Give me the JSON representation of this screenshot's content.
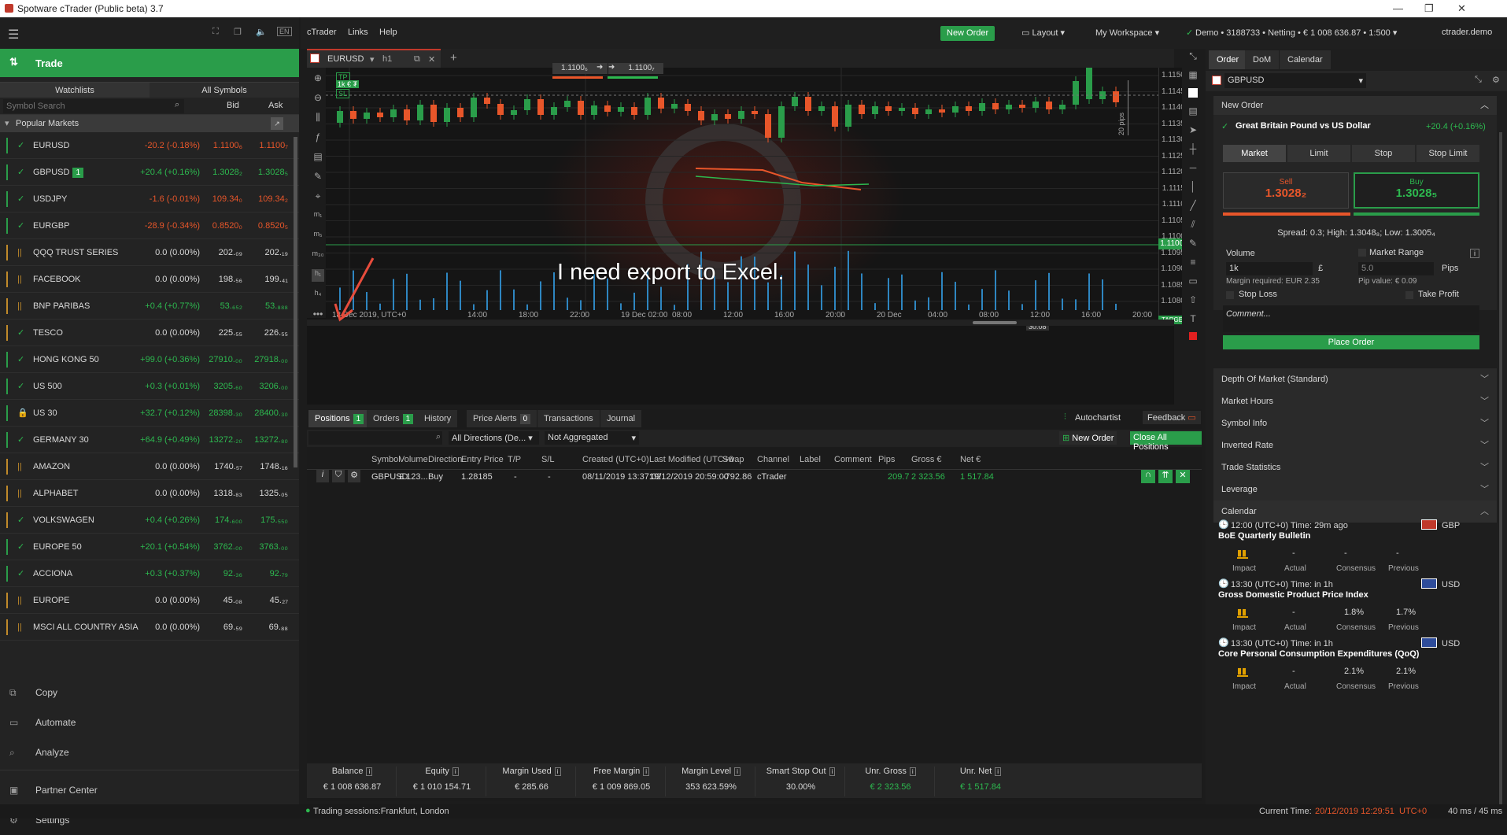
{
  "window": {
    "title": "Spotware cTrader (Public beta) 3.7",
    "min": "—",
    "max": "❐",
    "close": "✕"
  },
  "left": {
    "trade_label": "Trade",
    "tabs": [
      "Watchlists",
      "All Symbols"
    ],
    "search_placeholder": "Symbol Search",
    "bid_hdr": "Bid",
    "ask_hdr": "Ask",
    "popular": "Popular Markets",
    "symbols": [
      {
        "name": "EURUSD",
        "chg": "-20.2 (-0.18%)",
        "bid": "1.1100₆",
        "ask": "1.1100₇",
        "dir": "neg",
        "bar": "#2a9d4a",
        "icon": "✓"
      },
      {
        "name": "GBPUSD",
        "chg": "+20.4 (+0.16%)",
        "bid": "1.3028₂",
        "ask": "1.3028₅",
        "dir": "pos",
        "bar": "#2a9d4a",
        "icon": "✓",
        "badge": "1"
      },
      {
        "name": "USDJPY",
        "chg": "-1.6 (-0.01%)",
        "bid": "109.34₀",
        "ask": "109.34₂",
        "dir": "neg",
        "bar": "#2a9d4a",
        "icon": "✓"
      },
      {
        "name": "EURGBP",
        "chg": "-28.9 (-0.34%)",
        "bid": "0.8520₀",
        "ask": "0.8520₅",
        "dir": "neg",
        "bar": "#2a9d4a",
        "icon": "✓"
      },
      {
        "name": "QQQ TRUST SERIES",
        "chg": "0.0 (0.00%)",
        "bid": "202.₀₉",
        "ask": "202.₁₉",
        "dir": "zero",
        "bar": "#c08a2a",
        "icon": "||"
      },
      {
        "name": "FACEBOOK",
        "chg": "0.0 (0.00%)",
        "bid": "198.₅₆",
        "ask": "199.₄₁",
        "dir": "zero",
        "bar": "#c08a2a",
        "icon": "||"
      },
      {
        "name": "BNP PARIBAS",
        "chg": "+0.4 (+0.77%)",
        "bid": "53.₆₅₂",
        "ask": "53.₈₈₈",
        "dir": "pos",
        "bar": "#c08a2a",
        "icon": "||"
      },
      {
        "name": "TESCO",
        "chg": "0.0 (0.00%)",
        "bid": "225.₅₅",
        "ask": "226.₅₅",
        "dir": "zero",
        "bar": "#c08a2a",
        "icon": "✓"
      },
      {
        "name": "HONG KONG 50",
        "chg": "+99.0 (+0.36%)",
        "bid": "27910.₀₀",
        "ask": "27918.₀₀",
        "dir": "pos",
        "bar": "#2a9d4a",
        "icon": "✓"
      },
      {
        "name": "US 500",
        "chg": "+0.3 (+0.01%)",
        "bid": "3205.₆₀",
        "ask": "3206.₀₀",
        "dir": "pos",
        "bar": "#2a9d4a",
        "icon": "✓"
      },
      {
        "name": "US 30",
        "chg": "+32.7 (+0.12%)",
        "bid": "28398.₃₀",
        "ask": "28400.₃₀",
        "dir": "pos",
        "bar": "#2a9d4a",
        "icon": "🔒"
      },
      {
        "name": "GERMANY 30",
        "chg": "+64.9 (+0.49%)",
        "bid": "13272.₂₀",
        "ask": "13272.₈₀",
        "dir": "pos",
        "bar": "#2a9d4a",
        "icon": "✓"
      },
      {
        "name": "AMAZON",
        "chg": "0.0 (0.00%)",
        "bid": "1740.₅₇",
        "ask": "1748.₁₆",
        "dir": "zero",
        "bar": "#c08a2a",
        "icon": "||"
      },
      {
        "name": "ALPHABET",
        "chg": "0.0 (0.00%)",
        "bid": "1318.₈₃",
        "ask": "1325.₀₅",
        "dir": "zero",
        "bar": "#c08a2a",
        "icon": "||"
      },
      {
        "name": "VOLKSWAGEN",
        "chg": "+0.4 (+0.26%)",
        "bid": "174.₆₀₀",
        "ask": "175.₅₅₀",
        "dir": "pos",
        "bar": "#c08a2a",
        "icon": "✓"
      },
      {
        "name": "EUROPE 50",
        "chg": "+20.1 (+0.54%)",
        "bid": "3762.₀₀",
        "ask": "3763.₀₀",
        "dir": "pos",
        "bar": "#2a9d4a",
        "icon": "✓"
      },
      {
        "name": "ACCIONA",
        "chg": "+0.3 (+0.37%)",
        "bid": "92.₃₆",
        "ask": "92.₇₉",
        "dir": "pos",
        "bar": "#2a9d4a",
        "icon": "✓"
      },
      {
        "name": "EUROPE",
        "chg": "0.0 (0.00%)",
        "bid": "45.₀₈",
        "ask": "45.₂₇",
        "dir": "zero",
        "bar": "#c08a2a",
        "icon": "||"
      },
      {
        "name": "MSCI ALL COUNTRY ASIA",
        "chg": "0.0 (0.00%)",
        "bid": "69.₅₉",
        "ask": "69.₈₈",
        "dir": "zero",
        "bar": "#c08a2a",
        "icon": "||"
      }
    ],
    "nav": [
      "Copy",
      "Automate",
      "Analyze",
      "Partner Center",
      "Settings"
    ]
  },
  "top": {
    "menus": [
      "cTrader",
      "Links",
      "Help"
    ],
    "new_order": "New Order",
    "layout": "Layout",
    "workspace": "My Workspace",
    "account": "Demo • 3188733 • Netting • € 1 008 636.87 • 1:500",
    "user": "ctrader.demo"
  },
  "chart": {
    "symbol": "EURUSD",
    "timeframe": "h1",
    "sell_price": "1.1100₆",
    "buy_price": "1.1100₇",
    "overlay": "I need export to Excel.",
    "pips_label": "20 pips",
    "current_price": "1.11007",
    "target": "TARGET",
    "timer": "30:08",
    "tp_label": "TP",
    "sl_label": "SL",
    "lot_label": "1k € ₮",
    "yticks": [
      "1.1150₀",
      "1.1145₀",
      "1.1140₀",
      "1.1135₀",
      "1.1130₀",
      "1.1125₀",
      "1.1120₀",
      "1.1115₀",
      "1.1110₀",
      "1.1105₀",
      "1.1100₀",
      "1.1095₀",
      "1.1090₀",
      "1.1085₀",
      "1.1080₀"
    ],
    "xticks": [
      "18 Dec 2019, UTC+0",
      "14:00",
      "18:00",
      "22:00",
      "19 Dec 02:00",
      "08:00",
      "12:00",
      "16:00",
      "20:00",
      "20 Dec",
      "04:00",
      "08:00",
      "12:00",
      "16:00",
      "20:00"
    ]
  },
  "bottom": {
    "tabs": [
      {
        "label": "Positions",
        "badge": "1"
      },
      {
        "label": "Orders",
        "badge": "1"
      },
      {
        "label": "History"
      },
      {
        "label": "Price Alerts",
        "badge": "0"
      },
      {
        "label": "Transactions"
      },
      {
        "label": "Journal"
      }
    ],
    "autochartist": "Autochartist",
    "feedback": "Feedback",
    "filter_dir": "All Directions (De...",
    "filter_agg": "Not Aggregated",
    "new_order": "New Order",
    "close_all": "Close All Positions",
    "columns": [
      "Symbol",
      "Volume",
      "Direction",
      "Entry Price",
      "T/P",
      "S/L",
      "Created (UTC+0)",
      "Last Modified (UTC+0",
      "Swap",
      "Channel",
      "Label",
      "Comment",
      "Pips",
      "Gross €",
      "Net €"
    ],
    "row": {
      "symbol": "GBPUSD",
      "volume": "£ 123...",
      "direction": "Buy",
      "entry": "1.28185",
      "tp": "-",
      "sl": "-",
      "created": "08/11/2019 13:37:02",
      "modified": "19/12/2019 20:59:00",
      "swap": "-792.86",
      "channel": "cTrader",
      "pips": "209.7",
      "gross": "2 323.56",
      "net": "1 517.84"
    },
    "summary": [
      {
        "k": "Balance",
        "v": "€ 1 008 636.87"
      },
      {
        "k": "Equity",
        "v": "€ 1 010 154.71"
      },
      {
        "k": "Margin Used",
        "v": "€ 285.66"
      },
      {
        "k": "Free Margin",
        "v": "€ 1 009 869.05"
      },
      {
        "k": "Margin Level",
        "v": "353 623.59%"
      },
      {
        "k": "Smart Stop Out",
        "v": "30.00%"
      },
      {
        "k": "Unr. Gross",
        "v": "€ 2 323.56"
      },
      {
        "k": "Unr. Net",
        "v": "€ 1 517.84"
      }
    ]
  },
  "right": {
    "tabs": [
      "Order",
      "DoM",
      "Calendar"
    ],
    "symbol": "GBPUSD",
    "new_order": "New Order",
    "pair_name": "Great Britain Pound vs US Dollar",
    "pair_chg": "+20.4 (+0.16%)",
    "order_types": [
      "Market",
      "Limit",
      "Stop",
      "Stop Limit"
    ],
    "sell_label": "Sell",
    "sell_price": "1.3028₂",
    "buy_label": "Buy",
    "buy_price": "1.3028₅",
    "spread": "Spread: 0.3; High: 1.3048₈; Low: 1.3005₄",
    "volume_label": "Volume",
    "volume_val": "1k",
    "currency": "£",
    "market_range": "Market Range",
    "range_val": "5.0",
    "pips": "Pips",
    "margin_req": "Margin required: EUR 2.35",
    "pip_value": "Pip value: € 0.09",
    "stop_loss": "Stop Loss",
    "take_profit": "Take Profit",
    "comment": "Comment...",
    "place_order": "Place Order",
    "sections": [
      "Depth Of Market (Standard)",
      "Market Hours",
      "Symbol Info",
      "Inverted Rate",
      "Trade Statistics",
      "Leverage"
    ],
    "calendar": "Calendar",
    "events": [
      {
        "time": "12:00  (UTC+0)  Time:  29m ago",
        "title": "BoE Quarterly Bulletin",
        "cur": "GBP",
        "actual": "-",
        "consensus": "-",
        "previous": "-"
      },
      {
        "time": "13:30  (UTC+0)  Time:  in 1h",
        "title": "Gross Domestic Product Price Index",
        "cur": "USD",
        "actual": "-",
        "consensus": "1.8%",
        "previous": "1.7%"
      },
      {
        "time": "13:30  (UTC+0)  Time:  in 1h",
        "title": "Core Personal Consumption Expenditures (QoQ)",
        "cur": "USD",
        "actual": "-",
        "consensus": "2.1%",
        "previous": "2.1%"
      }
    ],
    "cal_labels": [
      "Impact",
      "Actual",
      "Consensus",
      "Previous"
    ]
  },
  "status": {
    "sessions": "Trading sessions:Frankfurt, London",
    "current_time_label": "Current Time:",
    "current_time": "20/12/2019 12:29:51",
    "tz": "UTC+0",
    "latency": "40 ms / 45 ms"
  }
}
